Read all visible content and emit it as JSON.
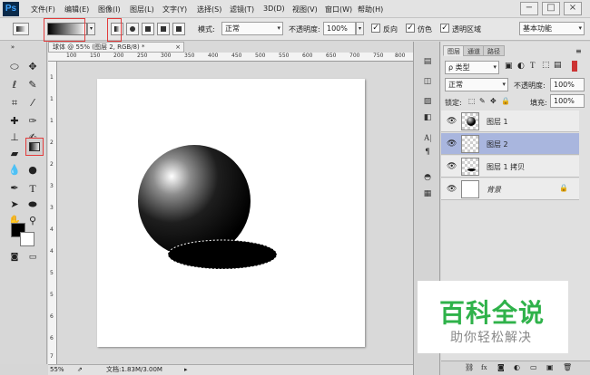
{
  "app": {
    "logo": "Ps"
  },
  "menu": [
    "文件(F)",
    "编辑(E)",
    "图像(I)",
    "图层(L)",
    "文字(Y)",
    "选择(S)",
    "滤镜(T)",
    "3D(D)",
    "视图(V)",
    "窗口(W)",
    "帮助(H)"
  ],
  "window_controls": {
    "minimize": "−",
    "restore": "□",
    "close": "×"
  },
  "options": {
    "mode_label": "模式:",
    "mode_value": "正常",
    "opacity_label": "不透明度:",
    "opacity_value": "100%",
    "reverse_label": "反向",
    "dither_label": "仿色",
    "transparency_label": "透明区域",
    "workspace_value": "基本功能"
  },
  "document": {
    "tab_title": "球体 @ 55% (图层 2, RGB/8) *",
    "tab_close": "×",
    "ruler_top": [
      "100",
      "150",
      "200",
      "250",
      "300",
      "350",
      "400",
      "450",
      "500",
      "550",
      "600",
      "650",
      "700",
      "750",
      "800"
    ],
    "ruler_left": [
      "1",
      "1",
      "1",
      "2",
      "2",
      "3",
      "3",
      "4",
      "4",
      "5",
      "5",
      "6",
      "6",
      "7"
    ]
  },
  "status": {
    "zoom": "55%",
    "doc_info": "文档:1.83M/3.00M"
  },
  "layers_panel": {
    "tabs": [
      "图层",
      "通道",
      "路径"
    ],
    "filter_label": "ρ 类型",
    "blend_mode": "正常",
    "opacity_label": "不透明度:",
    "opacity_value": "100%",
    "lock_label": "锁定:",
    "fill_label": "填充:",
    "fill_value": "100%",
    "layers": [
      {
        "name": "图层 1",
        "selected": false
      },
      {
        "name": "图层 2",
        "selected": true
      },
      {
        "name": "图层 1 拷贝",
        "selected": false
      },
      {
        "name": "背景",
        "selected": false
      }
    ]
  },
  "watermark": {
    "title": "百科全说",
    "subtitle": "助你轻松解决"
  },
  "colors": {
    "selected_layer": "#a9b6de",
    "highlight": "#e23b3b",
    "watermark_green": "#2fb24a"
  }
}
